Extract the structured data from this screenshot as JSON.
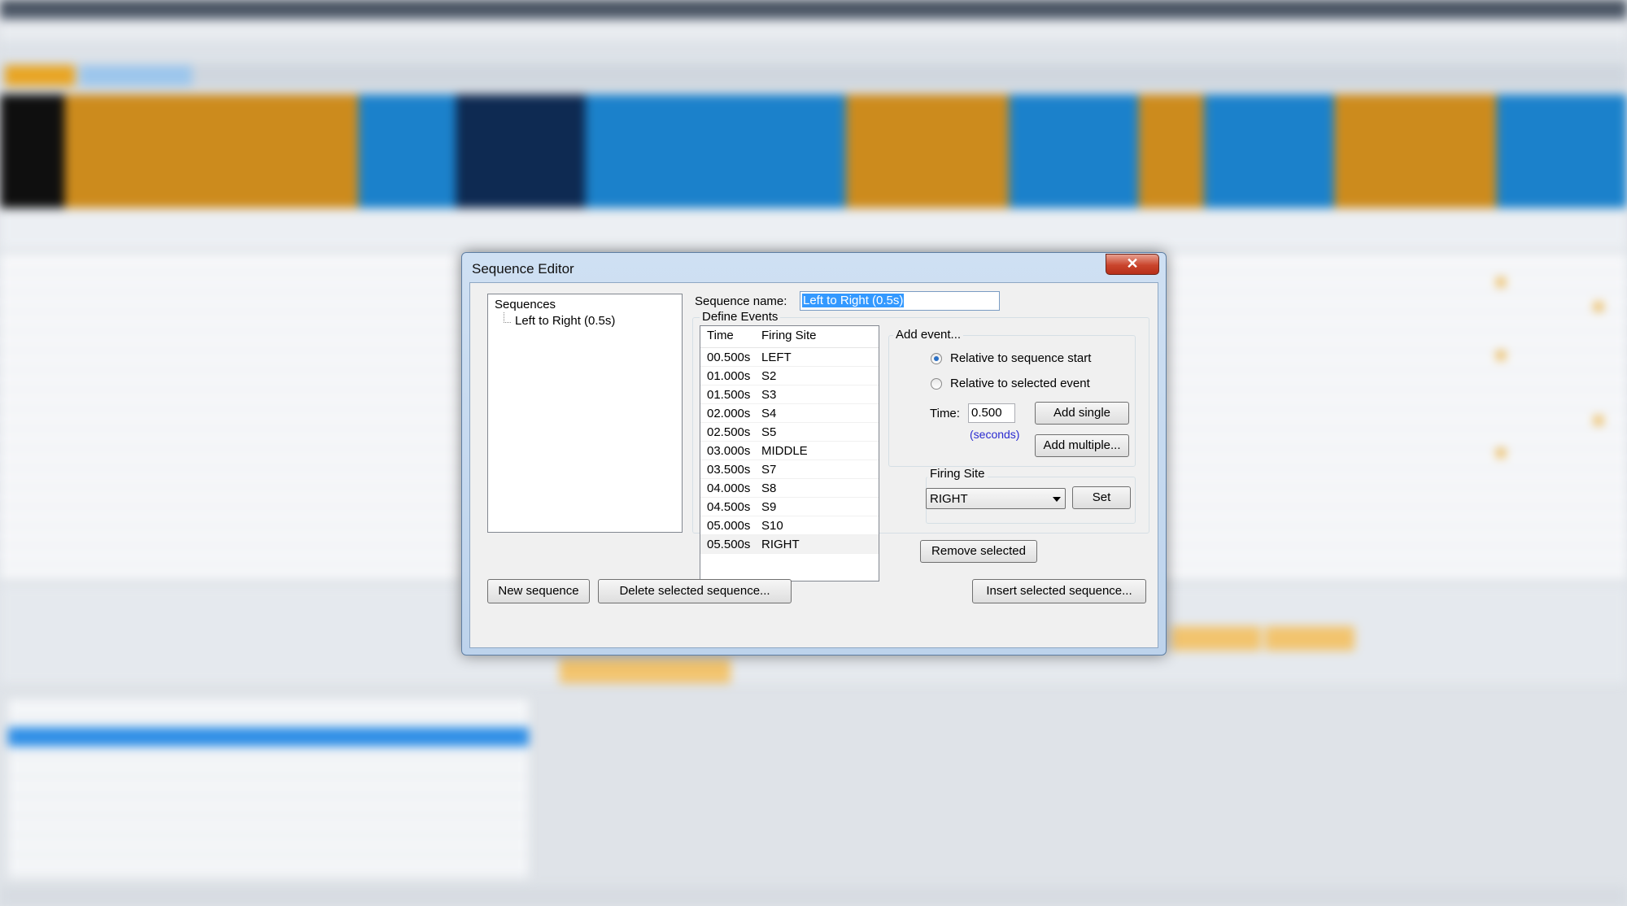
{
  "dialog": {
    "title": "Sequence Editor",
    "close_label": "✕",
    "sequences_root": "Sequences",
    "sequences": [
      "Left to Right (0.5s)"
    ],
    "sequence_name_label": "Sequence name:",
    "sequence_name_value": "Left to Right (0.5s)",
    "define_events_label": "Define Events",
    "events_columns": [
      "Time",
      "Firing Site"
    ],
    "events": [
      {
        "time": "00.500s",
        "site": "LEFT"
      },
      {
        "time": "01.000s",
        "site": "S2"
      },
      {
        "time": "01.500s",
        "site": "S3"
      },
      {
        "time": "02.000s",
        "site": "S4"
      },
      {
        "time": "02.500s",
        "site": "S5"
      },
      {
        "time": "03.000s",
        "site": "MIDDLE"
      },
      {
        "time": "03.500s",
        "site": "S7"
      },
      {
        "time": "04.000s",
        "site": "S8"
      },
      {
        "time": "04.500s",
        "site": "S9"
      },
      {
        "time": "05.000s",
        "site": "S10"
      },
      {
        "time": "05.500s",
        "site": "RIGHT"
      }
    ],
    "add_event_label": "Add event...",
    "radio_start": "Relative to sequence start",
    "radio_selected": "Relative to selected event",
    "time_label": "Time:",
    "time_value": "0.500",
    "seconds_label": "(seconds)",
    "add_single": "Add single",
    "add_multiple": "Add multiple...",
    "firing_site_label": "Firing Site",
    "firing_site_value": "RIGHT",
    "set_label": "Set",
    "remove_selected": "Remove selected",
    "new_sequence": "New sequence",
    "delete_sequence": "Delete selected sequence...",
    "insert_sequence": "Insert selected sequence..."
  },
  "colors": {
    "accent_orange": "#e29a20",
    "accent_blue": "#1e8fe0",
    "selection": "#3399ff",
    "close_red": "#c9442c",
    "seconds_blue": "#2a2ad0"
  }
}
